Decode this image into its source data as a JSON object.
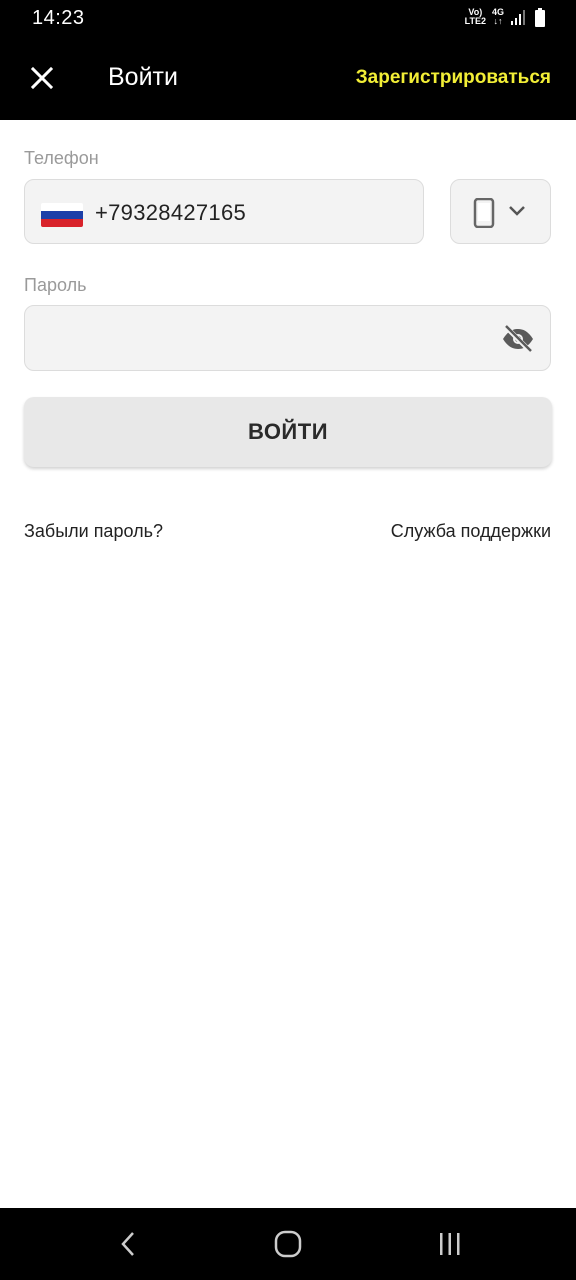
{
  "status_bar": {
    "time": "14:23",
    "network_line1": "Vo)",
    "network_line2": "LTE2",
    "network_type": "4G",
    "icons": [
      "signal-icon",
      "battery-icon"
    ]
  },
  "header": {
    "title": "Войти",
    "register_label": "Зарегистрироваться",
    "register_color": "#f2ee36",
    "close_icon": "close-icon"
  },
  "form": {
    "phone_label": "Телефон",
    "phone_value": "+79328427165",
    "country_flag": "russia-flag-icon",
    "device_icon": "smartphone-icon",
    "password_label": "Пароль",
    "password_value": "",
    "visibility_icon": "eye-off-icon",
    "login_label": "ВОЙТИ"
  },
  "links": {
    "forgot_password": "Забыли пароль?",
    "support": "Служба поддержки"
  },
  "nav_bar": {
    "icons": [
      "back-icon",
      "home-icon",
      "recents-icon"
    ]
  }
}
